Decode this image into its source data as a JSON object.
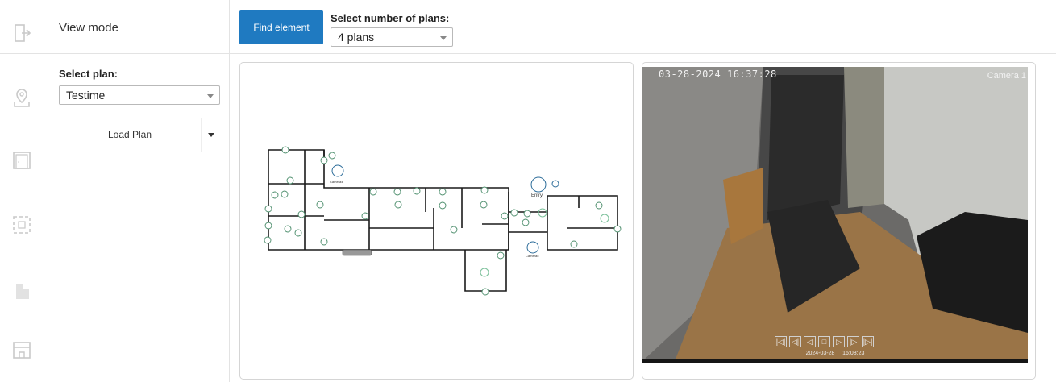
{
  "sidebar": {
    "icons": [
      "exit-icon",
      "location-pin-icon",
      "floor-plan-icon",
      "dashed-selection-icon",
      "building-icon",
      "store-icon"
    ]
  },
  "header": {
    "view_mode": "View mode",
    "find_button": "Find element",
    "plans_label": "Select number of plans:",
    "plans_value": "4 plans"
  },
  "left": {
    "select_plan_label": "Select plan:",
    "plan_value": "Testime",
    "load_plan": "Load Plan"
  },
  "floorplan": {
    "labels": {
      "camera4": "Camera4",
      "entry": "Entry",
      "camera5": "Camera5"
    }
  },
  "camera": {
    "timestamp": "03-28-2024 16:37:28",
    "name": "Camera 1",
    "controls": [
      "|◁|",
      "◁|",
      "◁",
      "□",
      "▷",
      "|▷",
      "|▷|"
    ],
    "playback_date": "2024-03-28",
    "playback_time": "16:08:23"
  },
  "colors": {
    "accent": "#1f7ac1"
  }
}
